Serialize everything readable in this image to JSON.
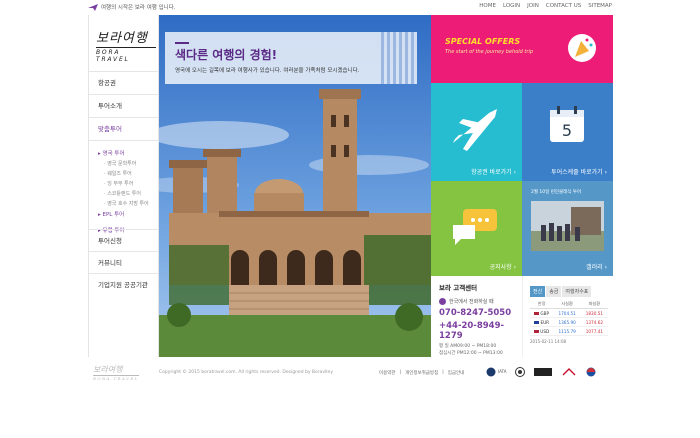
{
  "top": {
    "tagline": "여행의 시작은 보라 여행 입니다.",
    "links": [
      "HOME",
      "LOGIN",
      "JOIN",
      "CONTACT US",
      "SITEMAP"
    ]
  },
  "logo": {
    "korean": "보라여행",
    "english": "BORA TRAVEL"
  },
  "sidebar": {
    "menu": [
      "항공권",
      "투어소개",
      "맞춤투어"
    ],
    "sub": {
      "europe": "영국 투어",
      "europe_items": [
        "영국 문학투어",
        "웨일즈 투어",
        "잉 부부 투어",
        "스코틀랜드 투어",
        "영국 호수 지방 투어"
      ],
      "epl": "EPL 투어",
      "study": "유럽 투어"
    },
    "menu2": [
      "투어신청",
      "커뮤니티",
      "기업지원 공공기관"
    ]
  },
  "hero": {
    "title": "색다른 여행의 경험!",
    "subtitle": "영국에 오시는 길목에 보라 여행사가 있습니다.  여러분을 가족처럼 모시겠습니다."
  },
  "tiles": {
    "offer_title": "SPECIAL OFFERS",
    "offer_sub": "The start of the journey behold trip",
    "air": "항공권 바로가기 ›",
    "schedule": "투어스케줄 바로가기 ›",
    "schedule_day": "5",
    "notice": "공지사항 ›",
    "gallery_caption": "2월 10일 런던클래식 투어",
    "gallery": "갤러리 ›"
  },
  "customer_center": {
    "title": "보라 고객센터",
    "phone_hint": "한국에서 전화하실 때",
    "phone1": "070-8247-5050",
    "phone2": "+44-20-8949-1279",
    "hours1": "평    일  AM09:00 ~ PM18:00",
    "hours2": "점심시간  PM12:00 ~ PM13:00"
  },
  "exchange": {
    "tabs": [
      "전신",
      "송금",
      "여행자수표"
    ],
    "headers": [
      "한장",
      "사실환",
      "파실환"
    ],
    "rows": [
      {
        "code": "GBP",
        "buy": "1704.51",
        "sell": "1830.51",
        "color": "#b0243a"
      },
      {
        "code": "EUR",
        "buy": "1365.90",
        "sell": "1374.62",
        "color": "#223f9a"
      },
      {
        "code": "USD",
        "buy": "1115.79",
        "sell": "1077.41",
        "color": "#b0243a"
      }
    ],
    "date": "2015-02-11 14:08"
  },
  "footer": {
    "logo_ko": "보라여행",
    "logo_en": "BORA TRAVEL",
    "copyright": "Copyright © 2015 boratravel.com.  All rights reserved.  Designed by Boravlley",
    "links": [
      "이용약관",
      "|",
      "개인정보취급방침",
      "|",
      "임금안내"
    ],
    "partners": [
      "IATA",
      "KATA",
      "",
      "아시아나항공",
      "KOREAN AIR"
    ]
  },
  "colors": {
    "brand_purple": "#7b3fa0",
    "offer_pink": "#ec1c77",
    "air_teal": "#27bdd0",
    "schedule_blue": "#3b7fc9",
    "notice_green": "#84c441",
    "gallery_blue": "#5598c8"
  }
}
